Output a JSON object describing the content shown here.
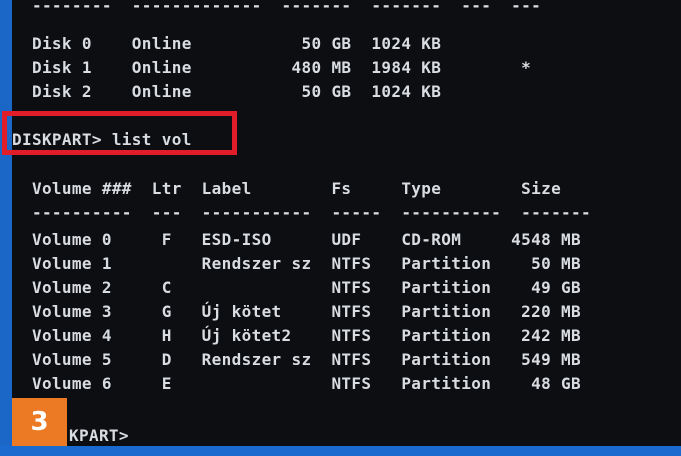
{
  "terminal": {
    "disk_header_rule": "  --------  -------------  -------  -------  ---  ---",
    "disk_rows": [
      "  Disk 0    Online           50 GB  1024 KB",
      "  Disk 1    Online          480 MB  1984 KB        *",
      "  Disk 2    Online           50 GB  1024 KB"
    ],
    "command": "DISKPART> list vol",
    "volume_header": "  Volume ###  Ltr  Label        Fs     Type        Size",
    "volume_rule": "  ----------  ---  -----------  -----  ----------  -------",
    "volume_rows": [
      "  Volume 0     F   ESD-ISO      UDF    CD-ROM     4548 MB",
      "  Volume 1         Rendszer sz  NTFS   Partition    50 MB",
      "  Volume 2     C                NTFS   Partition    49 GB",
      "  Volume 3     G   Új kötet     NTFS   Partition   220 MB",
      "  Volume 4     H   Új kötet2    NTFS   Partition   242 MB",
      "  Volume 5     D   Rendszer sz  NTFS   Partition   549 MB",
      "  Volume 6     E                NTFS   Partition    48 GB"
    ],
    "prompt": "KPART>"
  },
  "badge": {
    "label": "3"
  },
  "colors": {
    "terminal_background": "#0c0e12",
    "terminal_text": "#d9dce0",
    "highlight_border": "#e11d2a",
    "badge_background": "#ec7a24",
    "window_frame": "#1a67c8"
  }
}
